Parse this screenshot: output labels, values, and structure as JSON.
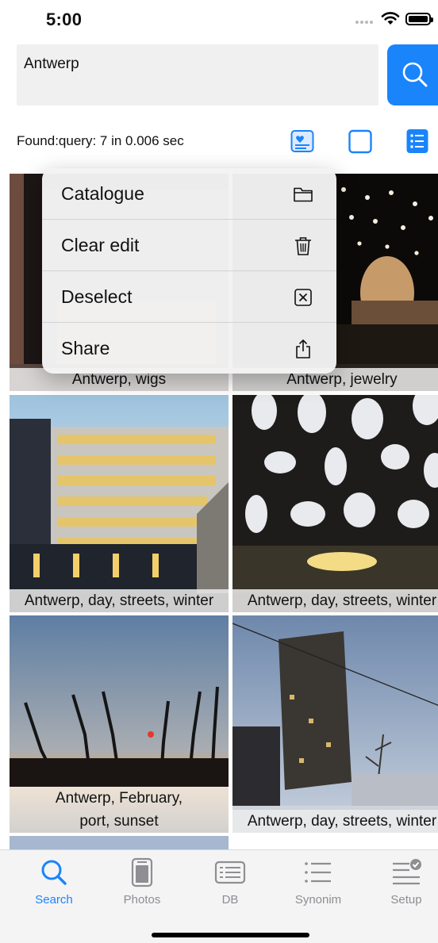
{
  "status_bar": {
    "time": "5:00"
  },
  "search": {
    "value": "Antwerp",
    "button_icon": "search-icon"
  },
  "results": {
    "summary": "Found:query: 7 in 0.006 sec"
  },
  "view_modes": [
    "picture-card-icon",
    "square-icon",
    "list-icon"
  ],
  "photos": [
    {
      "caption": "Antwerp, wigs"
    },
    {
      "caption": "Antwerp, jewelry"
    },
    {
      "caption": "Antwerp, day, streets, winter"
    },
    {
      "caption": "Antwerp, day, streets, winter"
    },
    {
      "caption_line1": "Antwerp, February,",
      "caption_line2": "port, sunset"
    },
    {
      "caption": "Antwerp, day, streets, winter"
    }
  ],
  "context_menu": {
    "items": [
      {
        "label": "Catalogue",
        "icon": "folder-icon"
      },
      {
        "label": "Clear edit",
        "icon": "trash-icon"
      },
      {
        "label": "Deselect",
        "icon": "xmark-square-icon"
      },
      {
        "label": "Share",
        "icon": "share-icon"
      }
    ]
  },
  "tab_bar": {
    "tabs": [
      {
        "label": "Search",
        "icon": "search-icon",
        "active": true
      },
      {
        "label": "Photos",
        "icon": "photos-icon",
        "active": false
      },
      {
        "label": "DB",
        "icon": "db-icon",
        "active": false
      },
      {
        "label": "Synonim",
        "icon": "list-icon",
        "active": false
      },
      {
        "label": "Setup",
        "icon": "setup-icon",
        "active": false
      }
    ]
  },
  "colors": {
    "accent": "#1a84fb",
    "inactive": "#8e8e93"
  }
}
